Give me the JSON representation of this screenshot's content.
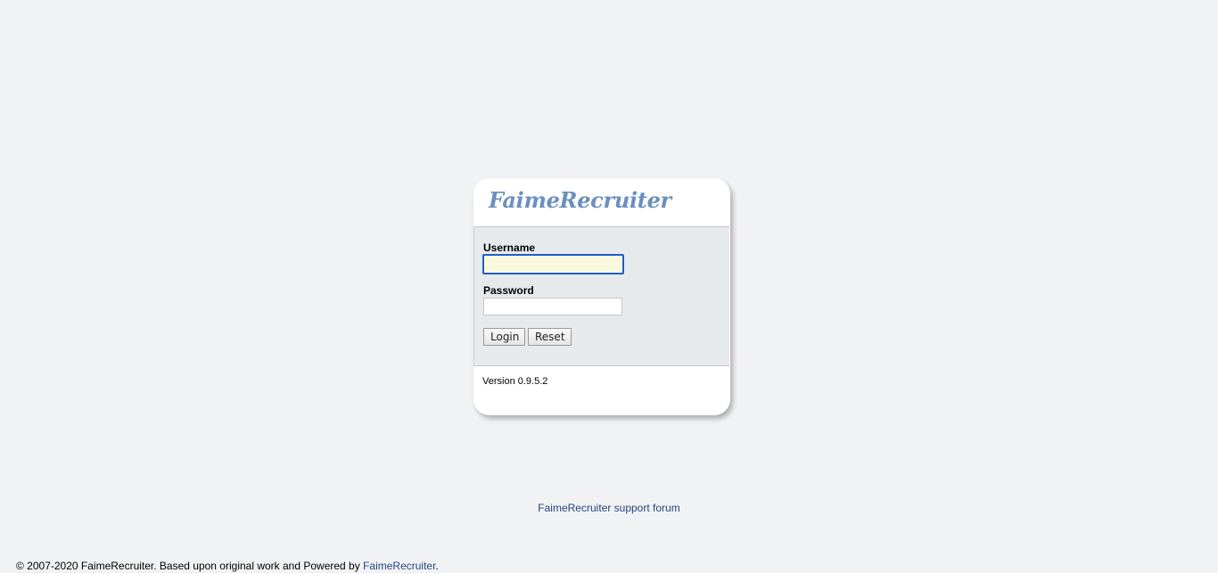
{
  "login": {
    "logo_text": "FaimeRecruiter",
    "username_label": "Username",
    "username_value": "",
    "password_label": "Password",
    "password_value": "",
    "login_button": "Login",
    "reset_button": "Reset",
    "version": "Version 0.9.5.2"
  },
  "support": {
    "link_text": "FaimeRecruiter support forum"
  },
  "footer": {
    "copyright": "© 2007-2020 FaimeRecruiter. Based upon original work and Powered by ",
    "powered_link": "FaimeRecruiter",
    "trailing": "."
  },
  "colors": {
    "background": "#f1f2f4",
    "logo": "#6b8fbf",
    "link": "#27457e",
    "focus_border": "#1f5fc9",
    "focused_input_bg": "#faf8dc"
  }
}
